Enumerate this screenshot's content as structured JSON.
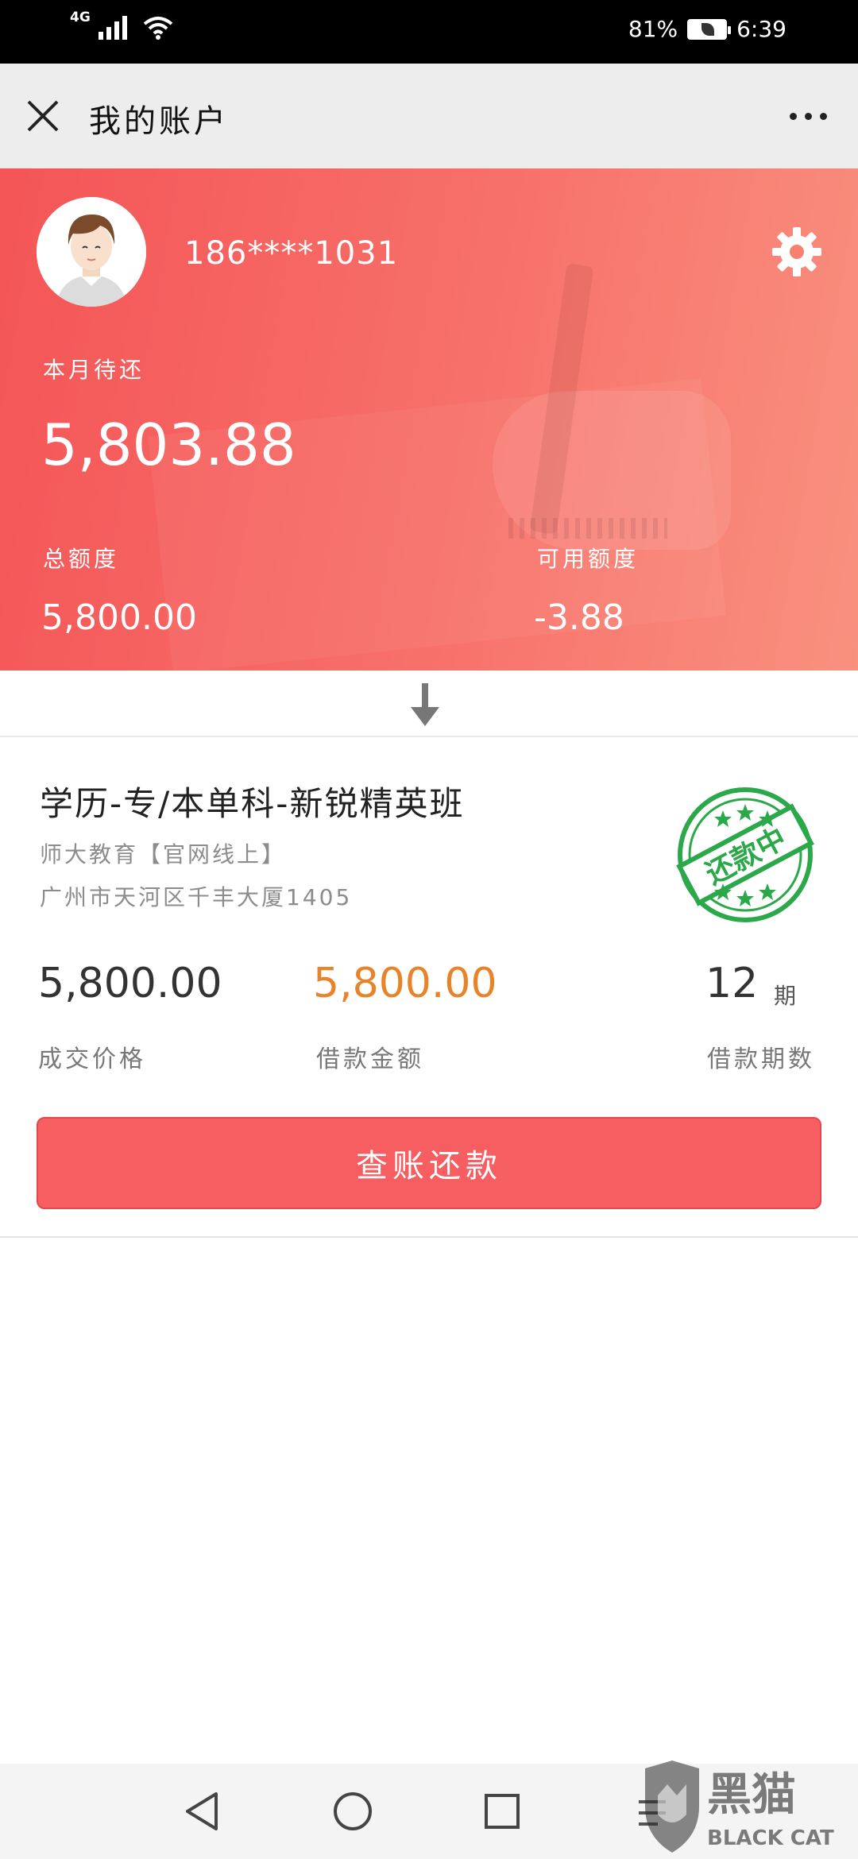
{
  "status_bar": {
    "network": "4G",
    "battery": "81%",
    "time": "6:39"
  },
  "header": {
    "title": "我的账户"
  },
  "account": {
    "phone": "186****1031",
    "due_label": "本月待还",
    "due_amount": "5,803.88",
    "total_label": "总额度",
    "total_value": "5,800.00",
    "available_label": "可用额度",
    "available_value": "-3.88"
  },
  "course": {
    "title": "学历-专/本单科-新锐精英班",
    "institution": "师大教育【官网线上】",
    "address": "广州市天河区千丰大厦1405",
    "stamp_text": "还款中",
    "deal_price": "5,800.00",
    "deal_label": "成交价格",
    "loan_amount": "5,800.00",
    "loan_label": "借款金额",
    "periods": "12",
    "periods_unit": "期",
    "periods_label": "借款期数",
    "button_label": "查账还款"
  },
  "watermark": {
    "brand_cn": "黑猫",
    "brand_en": "BLACK CAT"
  },
  "colors": {
    "header_gradient_start": "#f45557",
    "header_gradient_end": "#f9917f",
    "loan_amount": "#e8832a",
    "button": "#f65e62",
    "stamp": "#2aa84a"
  }
}
